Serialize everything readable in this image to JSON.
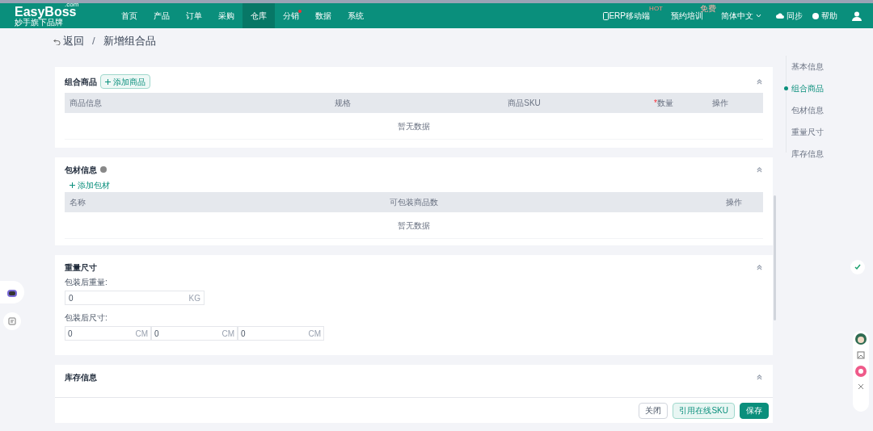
{
  "logo": {
    "name": "EasyBoss",
    "domain": ".com",
    "tagline": "妙手旗下品牌"
  },
  "nav": [
    {
      "label": "首页",
      "selected": false,
      "dot": false
    },
    {
      "label": "产品",
      "selected": false,
      "dot": false
    },
    {
      "label": "订单",
      "selected": false,
      "dot": false
    },
    {
      "label": "采购",
      "selected": false,
      "dot": false
    },
    {
      "label": "仓库",
      "selected": true,
      "dot": false
    },
    {
      "label": "分销",
      "selected": false,
      "dot": true
    },
    {
      "label": "数据",
      "selected": false,
      "dot": false
    },
    {
      "label": "系统",
      "selected": false,
      "dot": false
    }
  ],
  "header_right": {
    "mobile": "ERP移动端",
    "mobile_badge": "HOT",
    "training": "预约培训",
    "training_badge": "免费",
    "language": "简体中文",
    "sync": "同步",
    "help": "帮助"
  },
  "breadcrumb": {
    "back": "返回",
    "separator": "/",
    "title": "新增组合品"
  },
  "bundle": {
    "title": "组合商品",
    "add": "添加商品",
    "required_mark": "*",
    "columns": [
      {
        "label": "商品信息",
        "required": false
      },
      {
        "label": "规格",
        "required": false
      },
      {
        "label": "商品SKU",
        "required": false
      },
      {
        "label": "数量",
        "required": true
      },
      {
        "label": "操作",
        "required": false
      }
    ],
    "empty": "暂无数据"
  },
  "packaging": {
    "title": "包材信息",
    "add": "添加包材",
    "columns": [
      "名称",
      "可包装商品数",
      "操作"
    ],
    "empty": "暂无数据"
  },
  "dimensions": {
    "title": "重量尺寸",
    "weight_label": "包装后重量:",
    "weight": {
      "value": "0",
      "unit": "KG"
    },
    "size_label": "包装后尺寸:",
    "sizes": [
      {
        "value": "0",
        "unit": "CM"
      },
      {
        "value": "0",
        "unit": "CM"
      },
      {
        "value": "0",
        "unit": "CM"
      }
    ]
  },
  "inventory": {
    "title": "库存信息"
  },
  "anchors": [
    {
      "label": "基本信息",
      "selected": false
    },
    {
      "label": "组合商品",
      "selected": true
    },
    {
      "label": "包材信息",
      "selected": false
    },
    {
      "label": "重量尺寸",
      "selected": false
    },
    {
      "label": "库存信息",
      "selected": false
    }
  ],
  "footer": {
    "buttons": [
      {
        "label": "关闭",
        "kind": "plain"
      },
      {
        "label": "引用在线SKU",
        "kind": "light"
      },
      {
        "label": "保存",
        "kind": "primary"
      }
    ]
  }
}
